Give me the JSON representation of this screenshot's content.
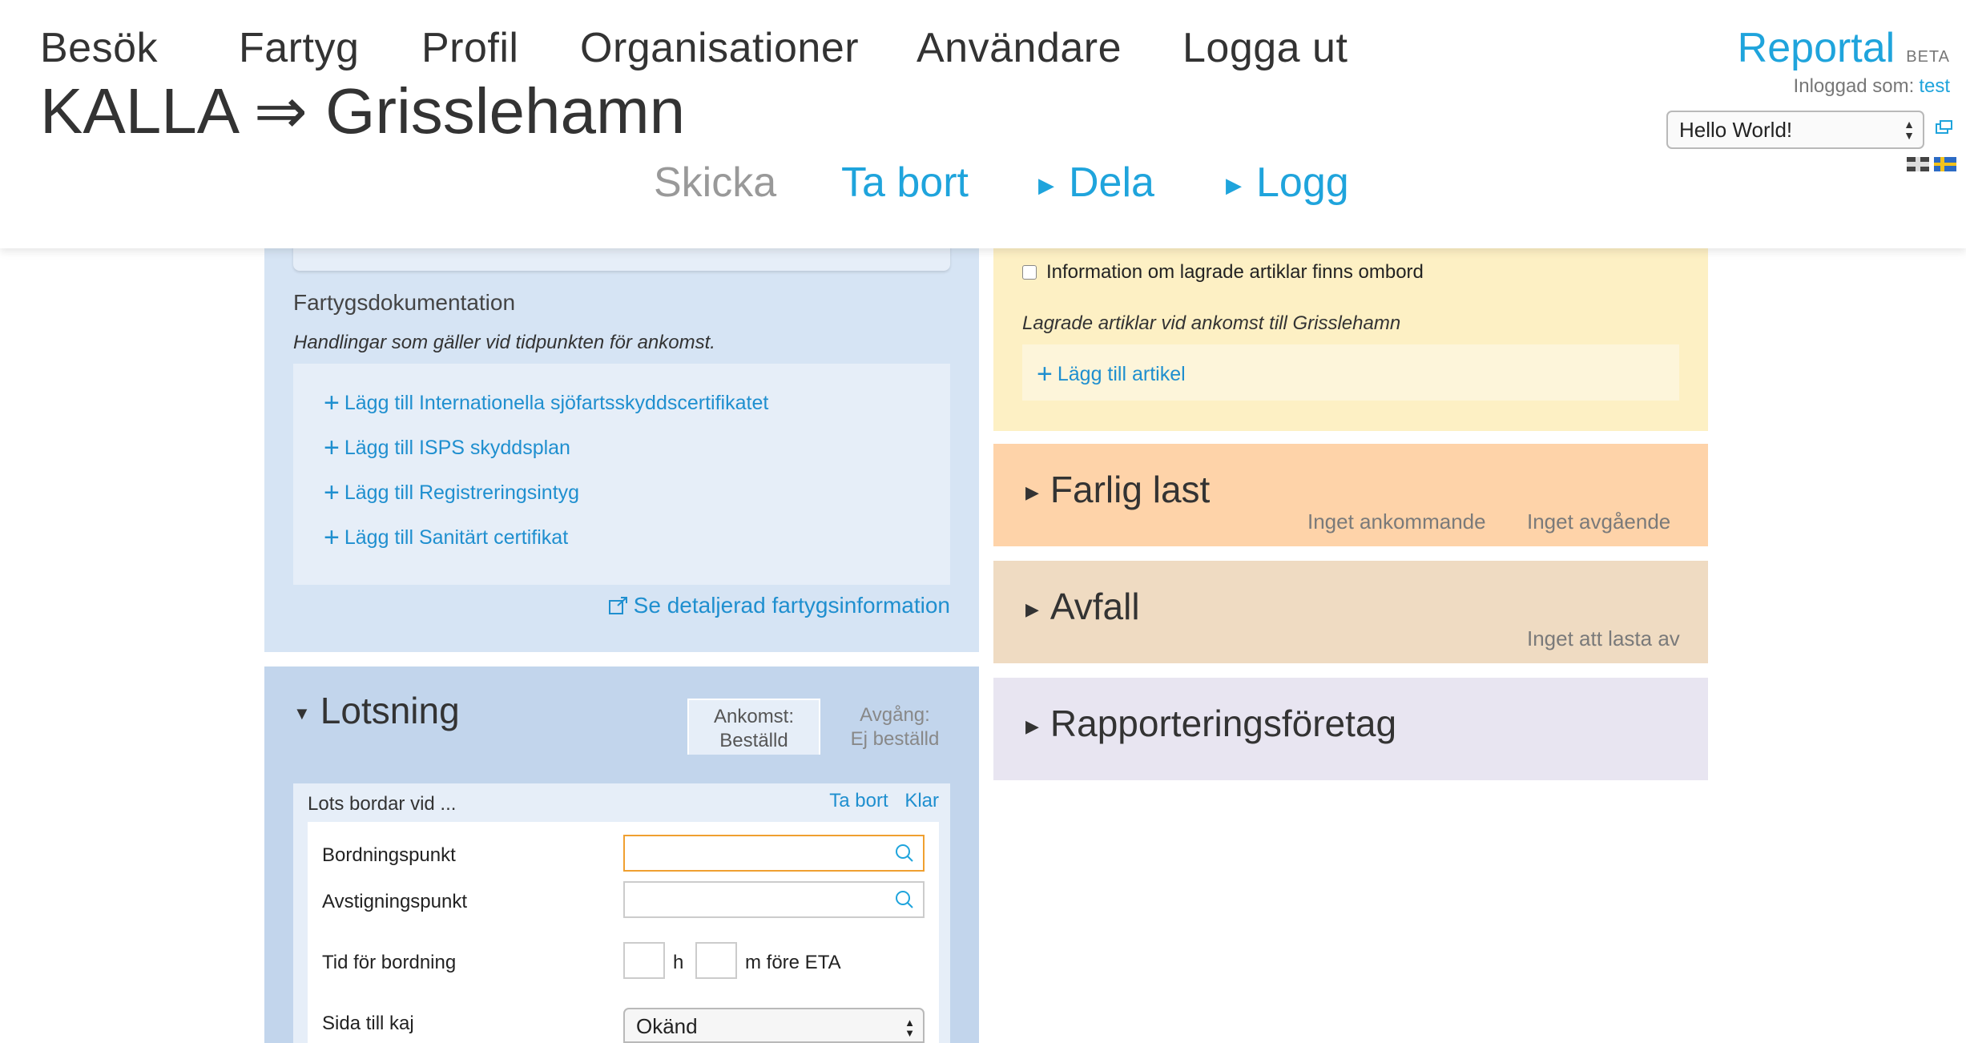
{
  "nav": {
    "items": [
      "Besök",
      "Fartyg",
      "Profil",
      "Organisationer",
      "Användare",
      "Logga ut"
    ]
  },
  "page": {
    "title": "KALLA ⇒ Grisslehamn"
  },
  "brand": {
    "name": "Reportal",
    "badge": "BETA"
  },
  "login": {
    "label": "Inloggad som:",
    "user": "test"
  },
  "org_select": {
    "value": "Hello World!"
  },
  "actions": {
    "send": "Skicka",
    "delete": "Ta bort",
    "share": "Dela",
    "log": "Logg"
  },
  "ship_docs": {
    "heading": "Fartygsdokumentation",
    "subheading": "Handlingar som gäller vid tidpunkten för ankomst.",
    "links": [
      "Lägg till Internationella sjöfartsskyddscertifikatet",
      "Lägg till ISPS skyddsplan",
      "Lägg till Registreringsintyg",
      "Lägg till Sanitärt certifikat"
    ],
    "detail_link": "Se detaljerad fartygsinformation"
  },
  "pilotage": {
    "title": "Lotsning",
    "tab_arrival": {
      "label": "Ankomst:",
      "value": "Beställd"
    },
    "tab_departure": {
      "label": "Avgång:",
      "value": "Ej beställd"
    },
    "boarding_title": "Lots bordar vid ...",
    "remove": "Ta bort",
    "done": "Klar",
    "fields": {
      "boarding_point": "Bordningspunkt",
      "disembark_point": "Avstigningspunkt",
      "boarding_time": "Tid för bordning",
      "hours_unit": "h",
      "minutes_unit": "m före ETA",
      "quay_side": "Sida till kaj",
      "quay_side_value": "Okänd"
    }
  },
  "stored_items": {
    "checkbox_label": "Information om lagrade artiklar finns ombord",
    "subheading": "Lagrade artiklar vid ankomst till Grisslehamn",
    "add_link": "Lägg till artikel"
  },
  "dangerous_cargo": {
    "title": "Farlig last",
    "incoming": "Inget ankommande",
    "outgoing": "Inget avgående"
  },
  "waste": {
    "title": "Avfall",
    "status": "Inget att lasta av"
  },
  "reporting_company": {
    "title": "Rapporteringsföretag"
  },
  "colors": {
    "link": "#1fa4dc",
    "ship_panel": "#d6e4f4",
    "pilot_panel": "#c2d5ec",
    "stored_panel": "#fdf0c4",
    "dangerous_panel": "#fed3a9",
    "waste_panel": "#efdbc2",
    "reporting_panel": "#e8e5f1"
  }
}
